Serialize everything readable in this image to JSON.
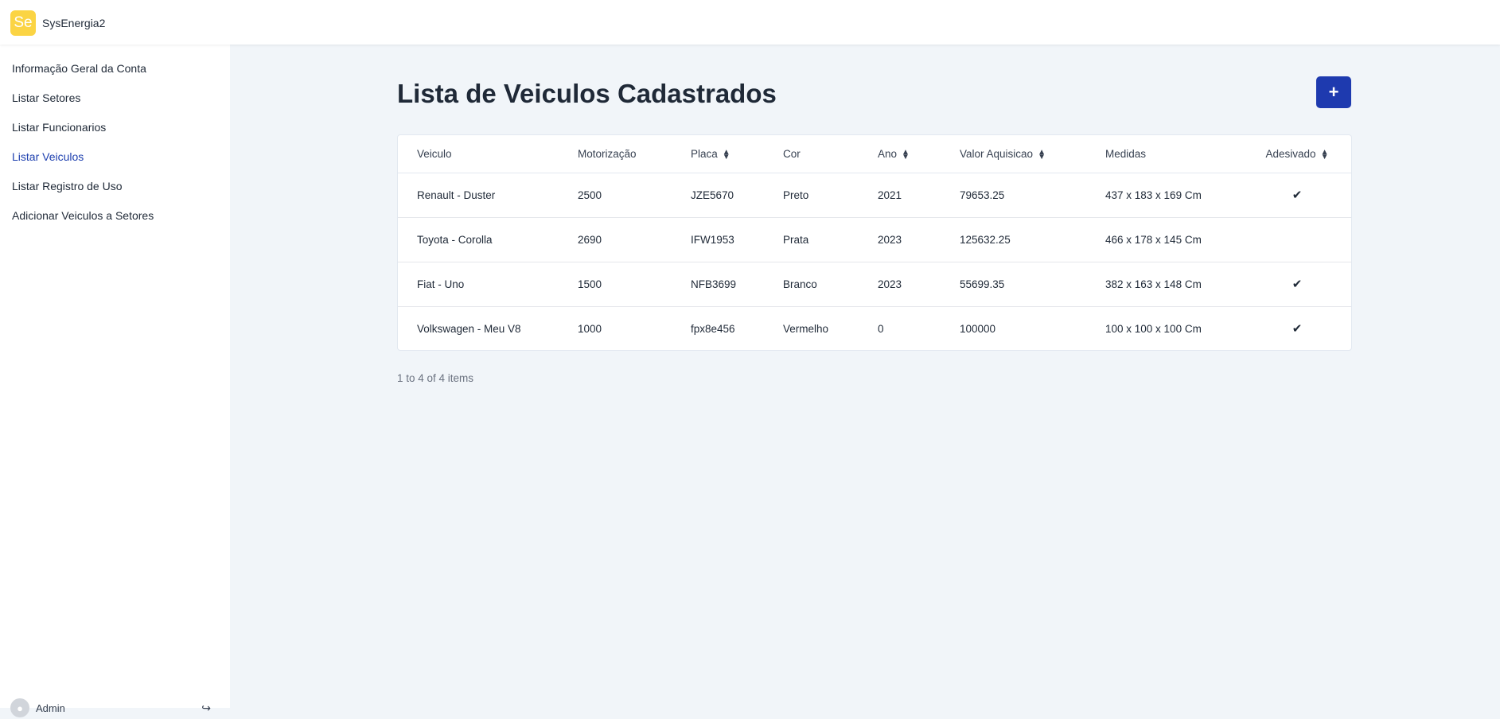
{
  "brand": {
    "logo_text": "Se",
    "name": "SysEnergia2",
    "logo_color": "#fbd444"
  },
  "sidebar": {
    "items": [
      {
        "label": "Informação Geral da Conta",
        "active": false
      },
      {
        "label": "Listar Setores",
        "active": false
      },
      {
        "label": "Listar Funcionarios",
        "active": false
      },
      {
        "label": "Listar Veiculos",
        "active": true
      },
      {
        "label": "Listar Registro de Uso",
        "active": false
      },
      {
        "label": "Adicionar Veiculos a Setores",
        "active": false
      }
    ],
    "user": {
      "name": "Admin",
      "avatar_icon": "user-avatar-icon",
      "logout_icon": "logout-icon"
    }
  },
  "main": {
    "title": "Lista de Veiculos Cadastrados",
    "add_button_label": "+",
    "accent_color": "#1e3aaf",
    "table": {
      "columns": [
        {
          "label": "Veiculo",
          "sortable": false
        },
        {
          "label": "Motorização",
          "sortable": false
        },
        {
          "label": "Placa",
          "sortable": true
        },
        {
          "label": "Cor",
          "sortable": false
        },
        {
          "label": "Ano",
          "sortable": true
        },
        {
          "label": "Valor Aquisicao",
          "sortable": true
        },
        {
          "label": "Medidas",
          "sortable": false
        },
        {
          "label": "Adesivado",
          "sortable": true
        }
      ],
      "rows": [
        {
          "veiculo": "Renault - Duster",
          "motorizacao": "2500",
          "placa": "JZE5670",
          "cor": "Preto",
          "ano": "2021",
          "valor": "79653.25",
          "medidas": "437 x 183 x 169 Cm",
          "adesivado": "✔"
        },
        {
          "veiculo": "Toyota - Corolla",
          "motorizacao": "2690",
          "placa": "IFW1953",
          "cor": "Prata",
          "ano": "2023",
          "valor": "125632.25",
          "medidas": "466 x 178 x 145 Cm",
          "adesivado": ""
        },
        {
          "veiculo": "Fiat - Uno",
          "motorizacao": "1500",
          "placa": "NFB3699",
          "cor": "Branco",
          "ano": "2023",
          "valor": "55699.35",
          "medidas": "382 x 163 x 148 Cm",
          "adesivado": "✔"
        },
        {
          "veiculo": "Volkswagen - Meu V8",
          "motorizacao": "1000",
          "placa": "fpx8e456",
          "cor": "Vermelho",
          "ano": "0",
          "valor": "100000",
          "medidas": "100 x 100 x 100 Cm",
          "adesivado": "✔"
        }
      ]
    },
    "pagination_summary": "1 to 4 of 4 items"
  }
}
